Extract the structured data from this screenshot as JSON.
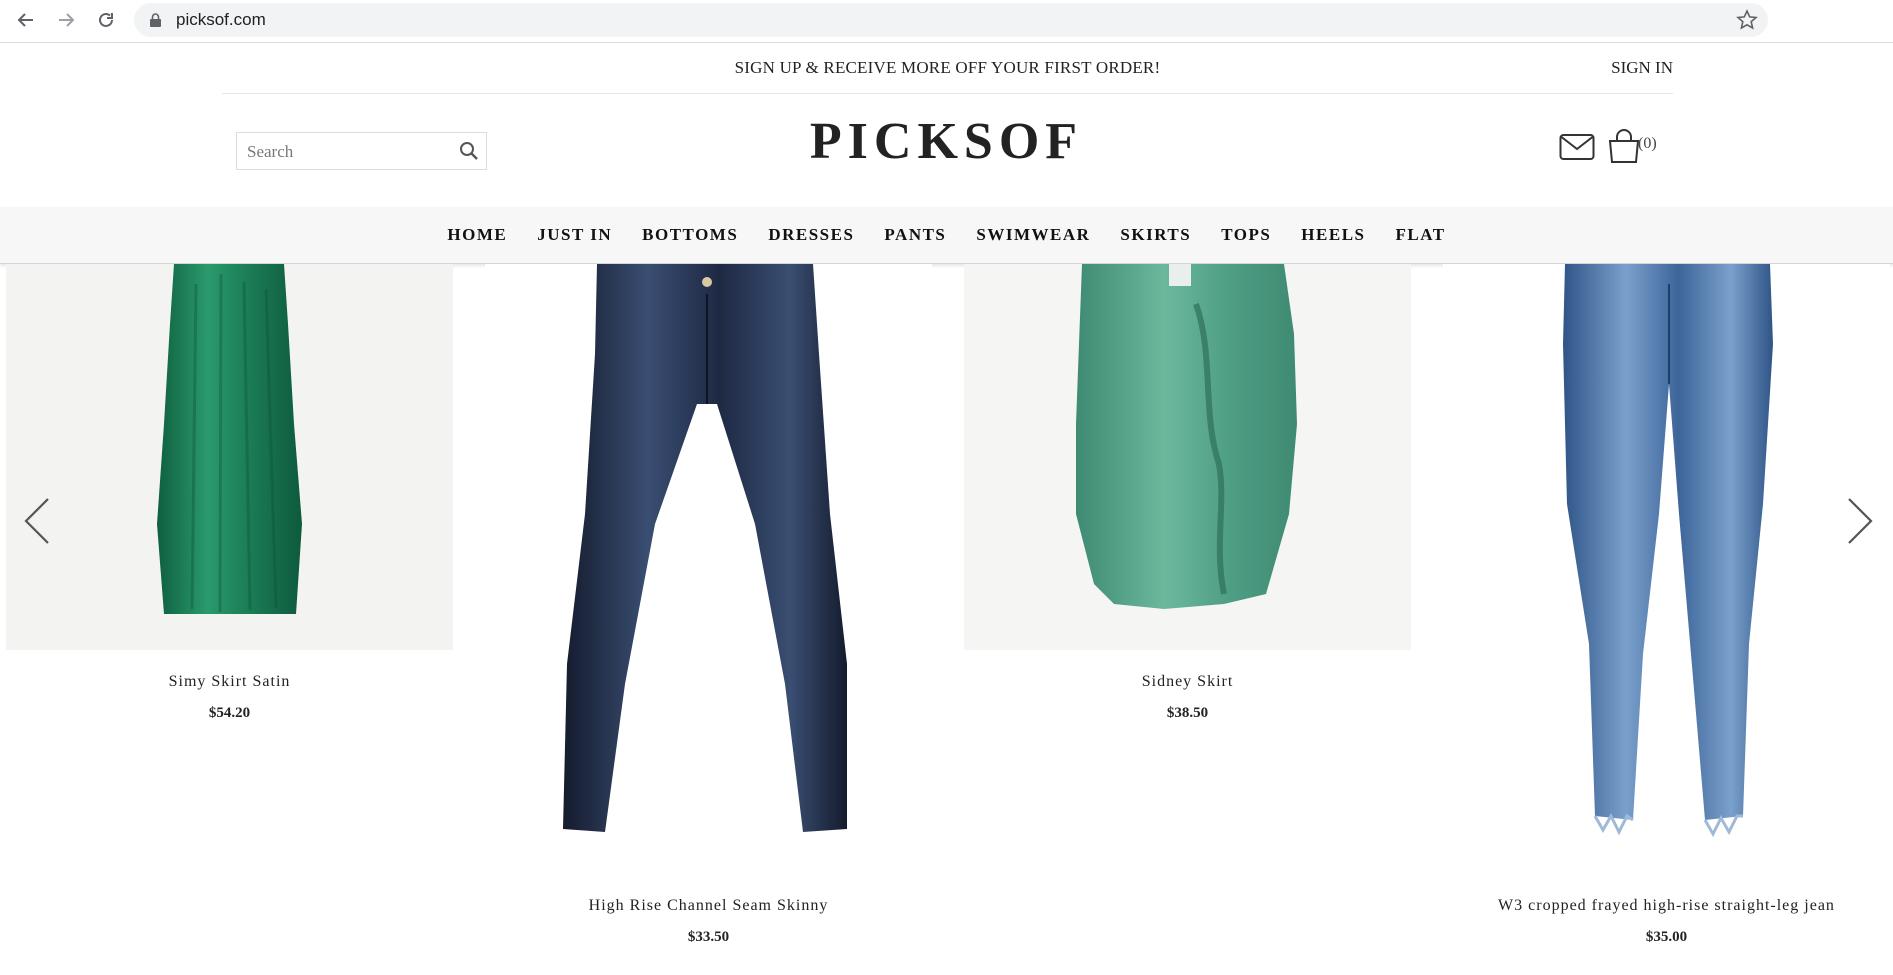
{
  "browser": {
    "url": "picksof.com"
  },
  "promo": {
    "text": "SIGN UP & RECEIVE MORE OFF YOUR FIRST ORDER!",
    "sign_in": "SIGN IN"
  },
  "header": {
    "search_placeholder": "Search",
    "logo": "PICKSOF",
    "cart_count": "(0)"
  },
  "nav": {
    "items": [
      "HOME",
      "JUST IN",
      "BOTTOMS",
      "DRESSES",
      "PANTS",
      "SWIMWEAR",
      "SKIRTS",
      "TOPS",
      "HEELS",
      "FLAT"
    ]
  },
  "products": [
    {
      "name": "Simy Skirt Satin",
      "price": "$54.20",
      "color": "#1f7a55"
    },
    {
      "name": "High Rise Channel Seam Skinny",
      "price": "$33.50",
      "color": "#1f2a44"
    },
    {
      "name": "Sidney Skirt",
      "price": "$38.50",
      "color": "#5fa890"
    },
    {
      "name": "W3 cropped frayed high-rise straight-leg jean",
      "price": "$35.00",
      "color": "#4a74a8"
    }
  ],
  "icons": {
    "back": "arrow-left-icon",
    "forward": "arrow-right-icon",
    "reload": "reload-icon",
    "lock": "lock-icon",
    "star": "star-icon",
    "search": "search-icon",
    "mail": "mail-icon",
    "bag": "shopping-bag-icon",
    "prev": "chevron-left-icon",
    "next": "chevron-right-icon"
  }
}
